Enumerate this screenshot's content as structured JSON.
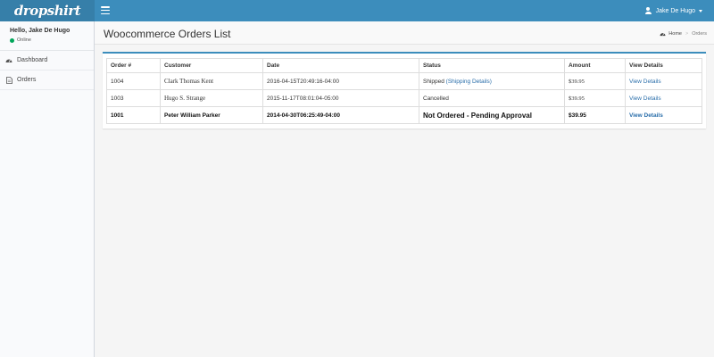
{
  "brand": {
    "logo_text": "dropshirt"
  },
  "header": {
    "user_name": "Jake De Hugo"
  },
  "sidebar": {
    "greeting": "Hello, Jake De Hugo",
    "status": "Online",
    "items": [
      {
        "label": "Dashboard",
        "icon": "dashboard-icon"
      },
      {
        "label": "Orders",
        "icon": "file-icon"
      }
    ]
  },
  "page": {
    "title": "Woocommerce Orders List",
    "breadcrumb": {
      "home": "Home",
      "current": "Orders"
    }
  },
  "table": {
    "headers": [
      "Order #",
      "Customer",
      "Date",
      "Status",
      "Amount",
      "View Details"
    ],
    "rows": [
      {
        "order": "1004",
        "customer": "Clark Thomas Kent",
        "date": "2016-04-15T20:49:16-04:00",
        "status": "Shipped",
        "status_link": "(Shipping Details)",
        "amount": "$39.95",
        "details": "View Details"
      },
      {
        "order": "1003",
        "customer": "Hugo S. Strange",
        "date": "2015-11-17T08:01:04-05:00",
        "status": "Cancelled",
        "status_link": "",
        "amount": "$39.95",
        "details": "View Details"
      },
      {
        "order": "1001",
        "customer": "Peter William Parker",
        "date": "2014-04-30T06:25:49-04:00",
        "status": "Not Ordered - Pending Approval",
        "status_link": "",
        "amount": "$39.95",
        "details": "View Details"
      }
    ]
  },
  "colors": {
    "header": "#3c8dbc",
    "logo_bg": "#367fa9",
    "online": "#00a65a",
    "link": "#2a6eaa"
  }
}
